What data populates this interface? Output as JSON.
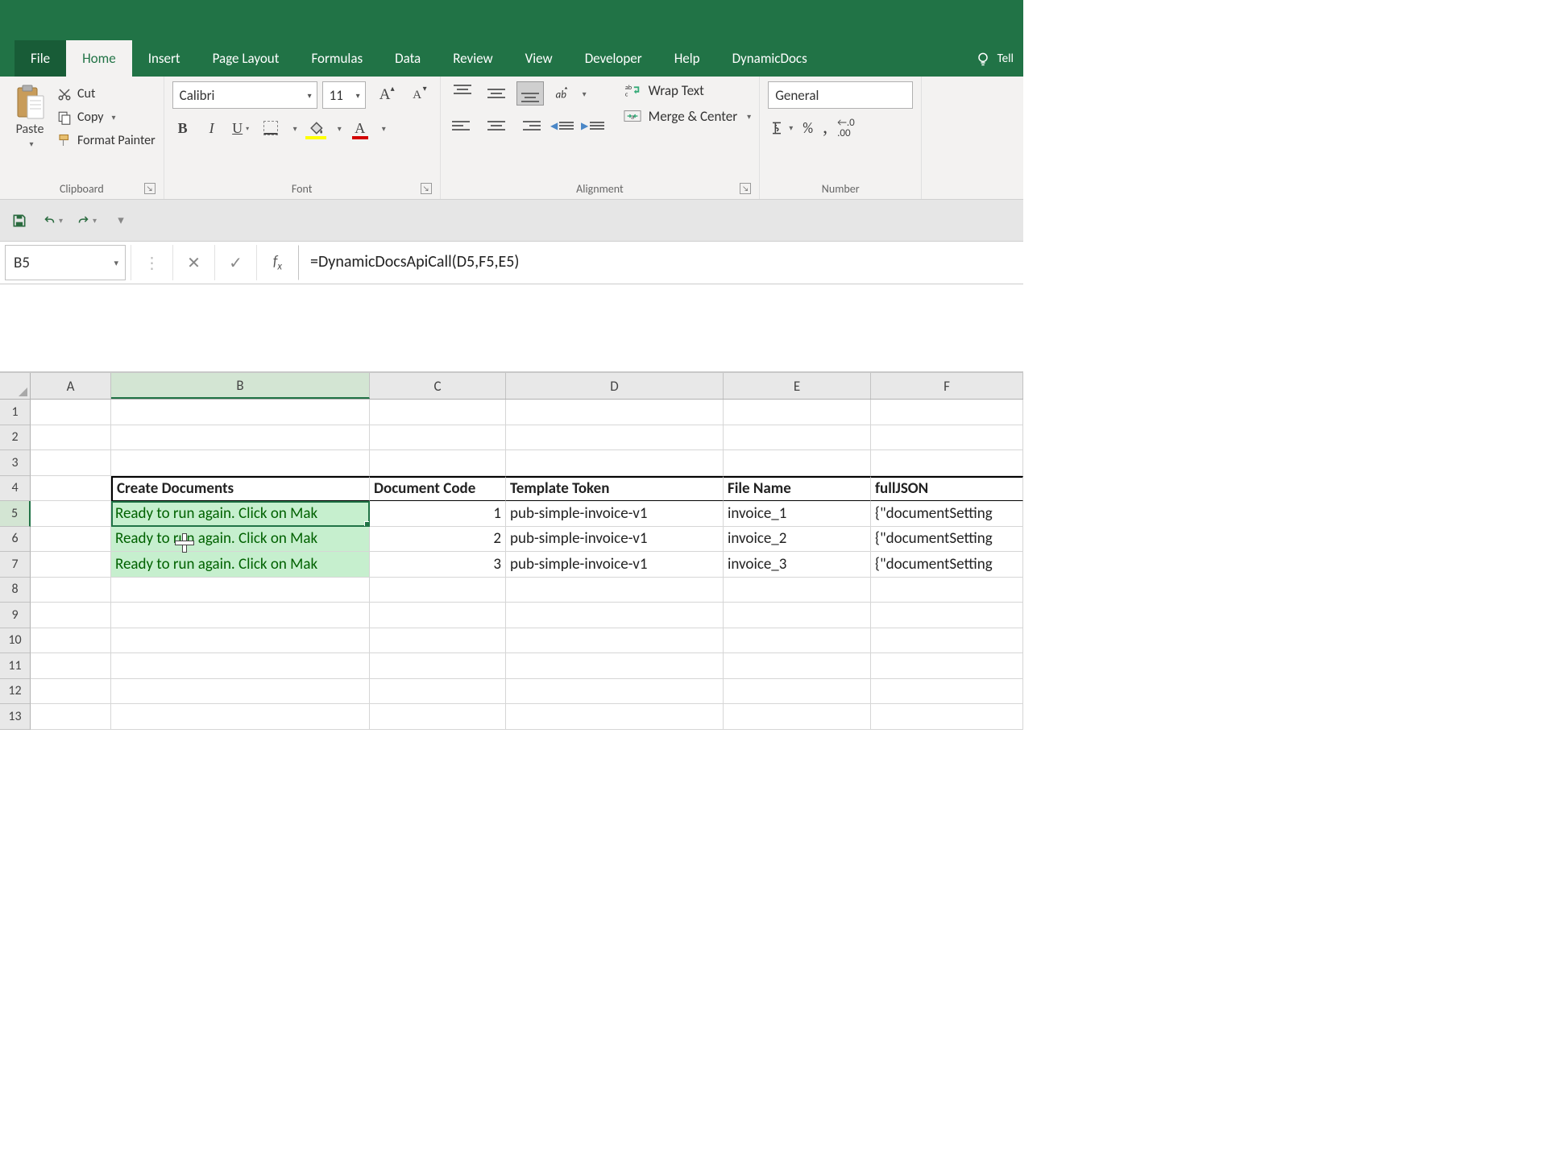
{
  "tabs": {
    "file": "File",
    "home": "Home",
    "insert": "Insert",
    "page_layout": "Page Layout",
    "formulas": "Formulas",
    "data": "Data",
    "review": "Review",
    "view": "View",
    "developer": "Developer",
    "help": "Help",
    "dynamicdocs": "DynamicDocs",
    "tell_me": "Tell"
  },
  "clipboard": {
    "paste": "Paste",
    "cut": "Cut",
    "copy": "Copy",
    "format_painter": "Format Painter",
    "group_label": "Clipboard"
  },
  "font": {
    "name": "Calibri",
    "size": "11",
    "group_label": "Font"
  },
  "alignment": {
    "wrap": "Wrap Text",
    "merge": "Merge & Center",
    "group_label": "Alignment"
  },
  "number": {
    "format": "General",
    "group_label": "Number"
  },
  "name_box": "B5",
  "formula": "=DynamicDocsApiCall(D5,F5,E5)",
  "columns": [
    "A",
    "B",
    "C",
    "D",
    "E",
    "F"
  ],
  "row_nums": [
    "1",
    "2",
    "3",
    "4",
    "5",
    "6",
    "7",
    "8",
    "9",
    "10",
    "11",
    "12",
    "13"
  ],
  "headers": {
    "B": "Create Documents",
    "C": "Document Code",
    "D": "Template Token",
    "E": "File Name",
    "F": "fullJSON"
  },
  "data_rows": [
    {
      "B": "Ready to run again. Click on Mak",
      "C": "1",
      "D": "pub-simple-invoice-v1",
      "E": "invoice_1",
      "F": "{\"documentSetting"
    },
    {
      "B": "Ready to run again. Click on Mak",
      "C": "2",
      "D": "pub-simple-invoice-v1",
      "E": "invoice_2",
      "F": "{\"documentSetting"
    },
    {
      "B": "Ready to run again. Click on Mak",
      "C": "3",
      "D": "pub-simple-invoice-v1",
      "E": "invoice_3",
      "F": "{\"documentSetting"
    }
  ]
}
